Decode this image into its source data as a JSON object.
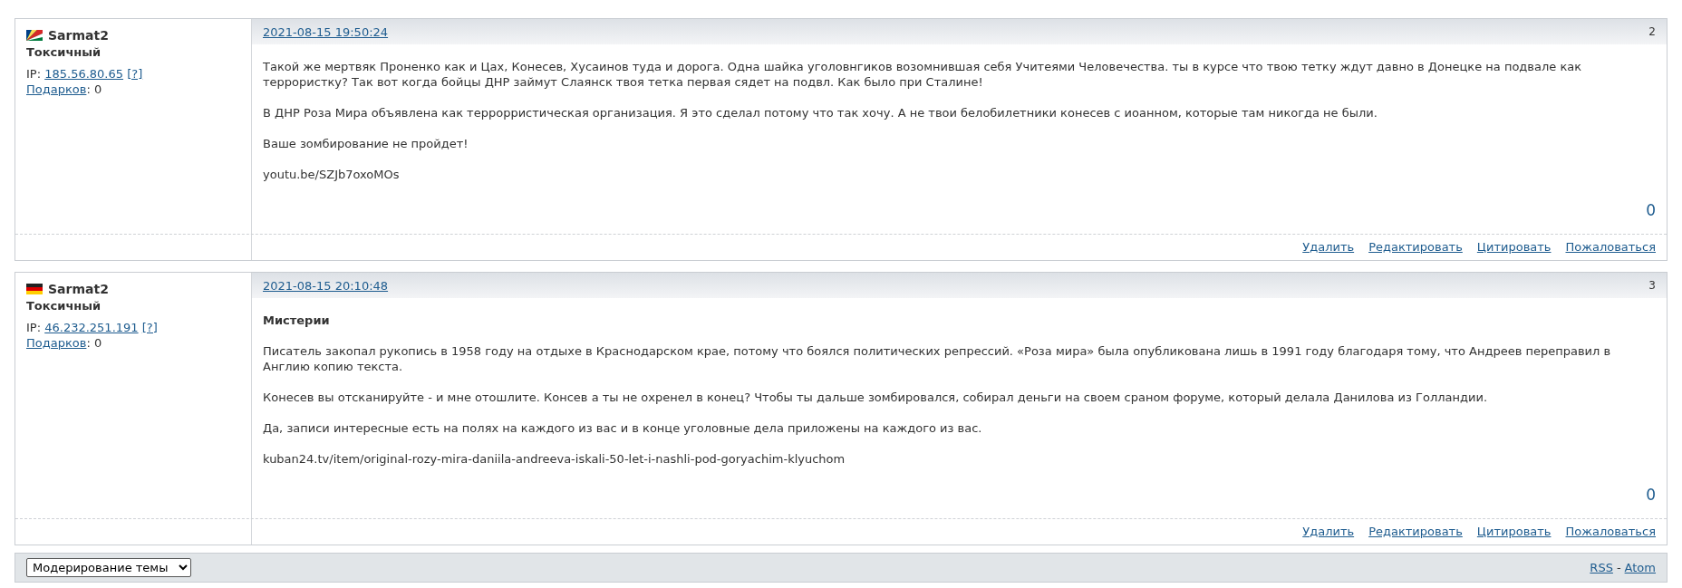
{
  "posts": [
    {
      "flag": {
        "kind": "seychelles"
      },
      "author": "Sarmat2",
      "status": "Токсичный",
      "ip_label": "IP:",
      "ip": "185.56.80.65",
      "ip_help": "[?]",
      "gifts_label": "Подарков",
      "gifts_suffix": ": 0",
      "date": "2021-08-15 19:50:24",
      "number": "2",
      "paragraphs": [
        "Такой же мертвяк Проненко как и Цах, Конесев, Хусаинов туда и дорога. Одна шайка уголовнгиков возомнившая себя Учитеями Человечества. ты в курсе что твою тетку ждут давно в Донецке на подвале как террористку? Так вот когда бойцы ДНР займут Слаянск твоя тетка первая сядет на подвл. Как было при Сталине!",
        "В ДНР Роза Мира объявлена как террорристическая организация. Я это сделал потому что так хочу. А не твои белобилетники конесев с иоанном, которые там никогда не были.",
        "Ваше зомбирование не пройдет!",
        "youtu.be/SZJb7oxoMOs"
      ],
      "rating": "0",
      "actions": [
        "Удалить",
        "Редактировать",
        "Цитировать",
        "Пожаловаться"
      ]
    },
    {
      "flag": {
        "kind": "germany"
      },
      "author": "Sarmat2",
      "status": "Токсичный",
      "ip_label": "IP:",
      "ip": "46.232.251.191",
      "ip_help": "[?]",
      "gifts_label": "Подарков",
      "gifts_suffix": ": 0",
      "date": "2021-08-15 20:10:48",
      "number": "3",
      "title": "Мистерии",
      "paragraphs": [
        "Писатель закопал рукопись в 1958 году на отдыхе в Краснодарском крае, потому что боялся политических репрессий. «Роза мира» была опубликована лишь в 1991 году благодаря тому, что Андреев переправил в Англию копию текста.",
        "Конесев вы отсканируйте - и мне отошлите. Консев а ты не охренел в конец? Чтобы ты дальше зомбировался, собирал деньги на своем сраном форуме, который делала Данилова из Голландии.",
        "Да, записи интересные есть на полях на каждого из вас и в конце уголовные дела приложены на каждого из вас.",
        "kuban24.tv/item/original-rozy-mira-daniila-andreeva-iskali-50-let-i-nashli-pod-goryachim-klyuchom"
      ],
      "rating": "0",
      "actions": [
        "Удалить",
        "Редактировать",
        "Цитировать",
        "Пожаловаться"
      ]
    }
  ],
  "footer": {
    "moderation_select": "Модерирование темы",
    "feeds": [
      {
        "label": "RSS"
      },
      {
        "label": "Atom"
      }
    ],
    "separator": "-"
  }
}
